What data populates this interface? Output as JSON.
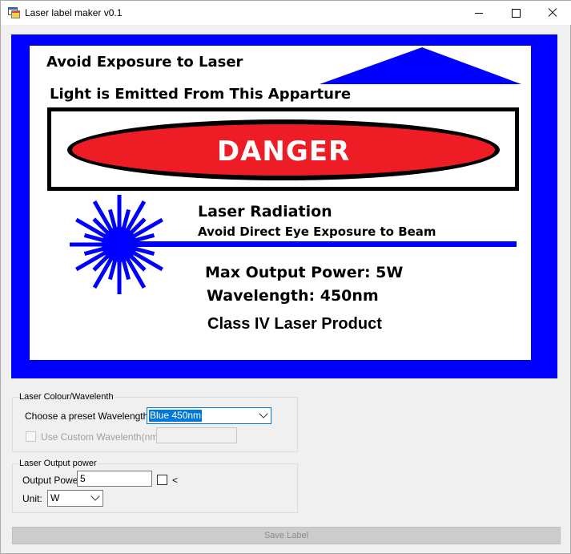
{
  "window": {
    "title": "Laser label maker v0.1",
    "icon": "app-window-icon",
    "controls": [
      "minimize-icon",
      "maximize-icon",
      "close-icon"
    ]
  },
  "label_preview": {
    "border_color": "#0000ff",
    "line1": "Avoid Exposure to Laser",
    "line2": "Light is Emitted From This Apparture",
    "danger": "DANGER",
    "danger_color": "#ee1c24",
    "radiation": "Laser Radiation",
    "eye_warning": "Avoid Direct Eye Exposure to Beam",
    "max_power": "Max Output Power: 5W",
    "wavelength": "Wavelength: 450nm",
    "class": "Class IV Laser Product",
    "beam_color": "#0000ff",
    "icons": [
      "aperture-triangle-icon",
      "laser-starburst-icon"
    ]
  },
  "wavelength_group": {
    "legend": "Laser Colour/Wavelenth",
    "preset_label": "Choose a preset Wavelength:",
    "preset_value": "Blue 450nm",
    "custom_label": "Use Custom Wavelenth(nm)",
    "custom_checked": false,
    "custom_value": ""
  },
  "power_group": {
    "legend": "Laser Output power",
    "power_label": "Output Power:",
    "power_value": "5",
    "less_than_label": "<",
    "less_than_checked": false,
    "unit_label": "Unit:",
    "unit_value": "W"
  },
  "save_button": "Save Label"
}
